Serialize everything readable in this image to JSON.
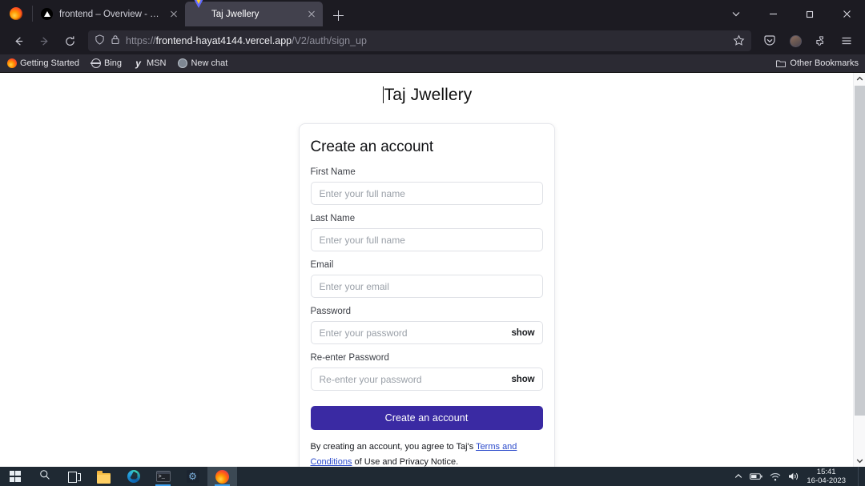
{
  "browser": {
    "tabs": [
      {
        "title": "frontend – Overview - Vercel",
        "favicon": "vercel-icon",
        "active": false
      },
      {
        "title": "Taj Jwellery",
        "favicon": "vite-icon",
        "active": true
      }
    ],
    "new_tab_label": "+",
    "window_controls": [
      "tab-list-chevron",
      "minimize",
      "restore",
      "close"
    ],
    "url": {
      "scheme": "https://",
      "host": "frontend-hayat4144.vercel.app",
      "path": "/V2/auth/sign_up",
      "full": "https://frontend-hayat4144.vercel.app/V2/auth/sign_up"
    },
    "toolbar_icons": [
      "back-icon",
      "forward-icon",
      "reload-icon",
      "shield-icon",
      "lock-icon",
      "bookmark-star-icon",
      "pocket-icon",
      "account-avatar-icon",
      "extensions-icon",
      "app-menu-icon"
    ],
    "bookmarks": [
      {
        "label": "Getting Started",
        "icon": "firefox-icon"
      },
      {
        "label": "Bing",
        "icon": "globe-icon"
      },
      {
        "label": "MSN",
        "icon": "msn-icon"
      },
      {
        "label": "New chat",
        "icon": "chat-icon"
      }
    ],
    "other_bookmarks": "Other Bookmarks"
  },
  "page": {
    "title": "Taj Jwellery",
    "card": {
      "heading": "Create an account",
      "fields": [
        {
          "label": "First Name",
          "placeholder": "Enter your full name",
          "type": "text",
          "value": "",
          "toggle": null
        },
        {
          "label": "Last Name",
          "placeholder": "Enter your full name",
          "type": "text",
          "value": "",
          "toggle": null
        },
        {
          "label": "Email",
          "placeholder": "Enter your email",
          "type": "email",
          "value": "",
          "toggle": null
        },
        {
          "label": "Password",
          "placeholder": "Enter your password",
          "type": "password",
          "value": "",
          "toggle": "show"
        },
        {
          "label": "Re-enter Password",
          "placeholder": "Re-enter your password",
          "type": "password",
          "value": "",
          "toggle": "show"
        }
      ],
      "submit_label": "Create an account",
      "terms": {
        "prefix": "By creating an account, you agree to Taj's",
        "link": "Terms and Conditions",
        "suffix": "of Use and Privacy Notice."
      }
    },
    "accent_color": "#3a2aa3",
    "link_color": "#2b4acb"
  },
  "taskbar": {
    "items": [
      {
        "name": "start-button",
        "icon": "windows-logo-icon",
        "running": false
      },
      {
        "name": "search-button",
        "icon": "search-icon",
        "running": false
      },
      {
        "name": "task-view-button",
        "icon": "task-view-icon",
        "running": false
      },
      {
        "name": "file-explorer",
        "icon": "folder-icon",
        "running": false
      },
      {
        "name": "microsoft-edge",
        "icon": "edge-icon",
        "running": false
      },
      {
        "name": "terminal",
        "icon": "terminal-icon",
        "running": true
      },
      {
        "name": "settings-app",
        "icon": "gear-icon",
        "running": false
      },
      {
        "name": "firefox",
        "icon": "firefox-icon",
        "running": true
      }
    ],
    "tray": [
      "show-hidden-icons",
      "battery-icon",
      "wifi-icon",
      "volume-icon"
    ],
    "clock_time": "15:41",
    "clock_date": "16-04-2023"
  }
}
